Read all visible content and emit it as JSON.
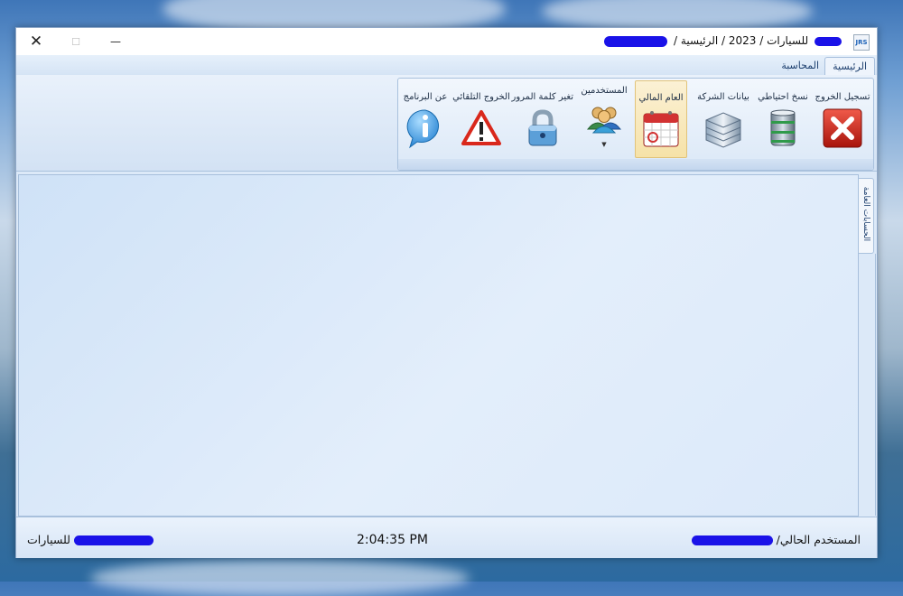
{
  "window": {
    "title": "للسيارات / 2023 / الرئيسية /",
    "app_icon_text": "JRS",
    "minimize_glyph": "—",
    "maximize_glyph": "☐",
    "close_glyph": "✕"
  },
  "tabs": [
    {
      "label": "الرئيسية",
      "active": true
    },
    {
      "label": "المحاسبة",
      "active": false
    }
  ],
  "ribbon": {
    "buttons": [
      {
        "label": "تسجيل الخروج",
        "icon": "logout-x-icon"
      },
      {
        "label": "نسخ احتياطي",
        "icon": "database-backup-icon"
      },
      {
        "label": "بيانات الشركة",
        "icon": "company-data-icon"
      },
      {
        "label": "العام المالي",
        "icon": "calendar-icon"
      },
      {
        "label": "المستخدمين",
        "icon": "users-icon",
        "dropdown_arrow": "▼"
      },
      {
        "label": "تغير كلمة المرور",
        "icon": "padlock-icon"
      },
      {
        "label": "الخروج التلقائي",
        "icon": "warning-triangle-icon"
      },
      {
        "label": "عن البرنامج",
        "icon": "info-icon"
      }
    ]
  },
  "side_tab": {
    "label": "الحسابات العامة"
  },
  "status": {
    "user_label": "المستخدم الحالي/",
    "time": "2:04:35 PM",
    "company": "للسيارات"
  },
  "colors": {
    "ribbon_hover": "#f6e2a8",
    "redaction": "#1a12e8",
    "client_bg": "#dbe9f9"
  }
}
